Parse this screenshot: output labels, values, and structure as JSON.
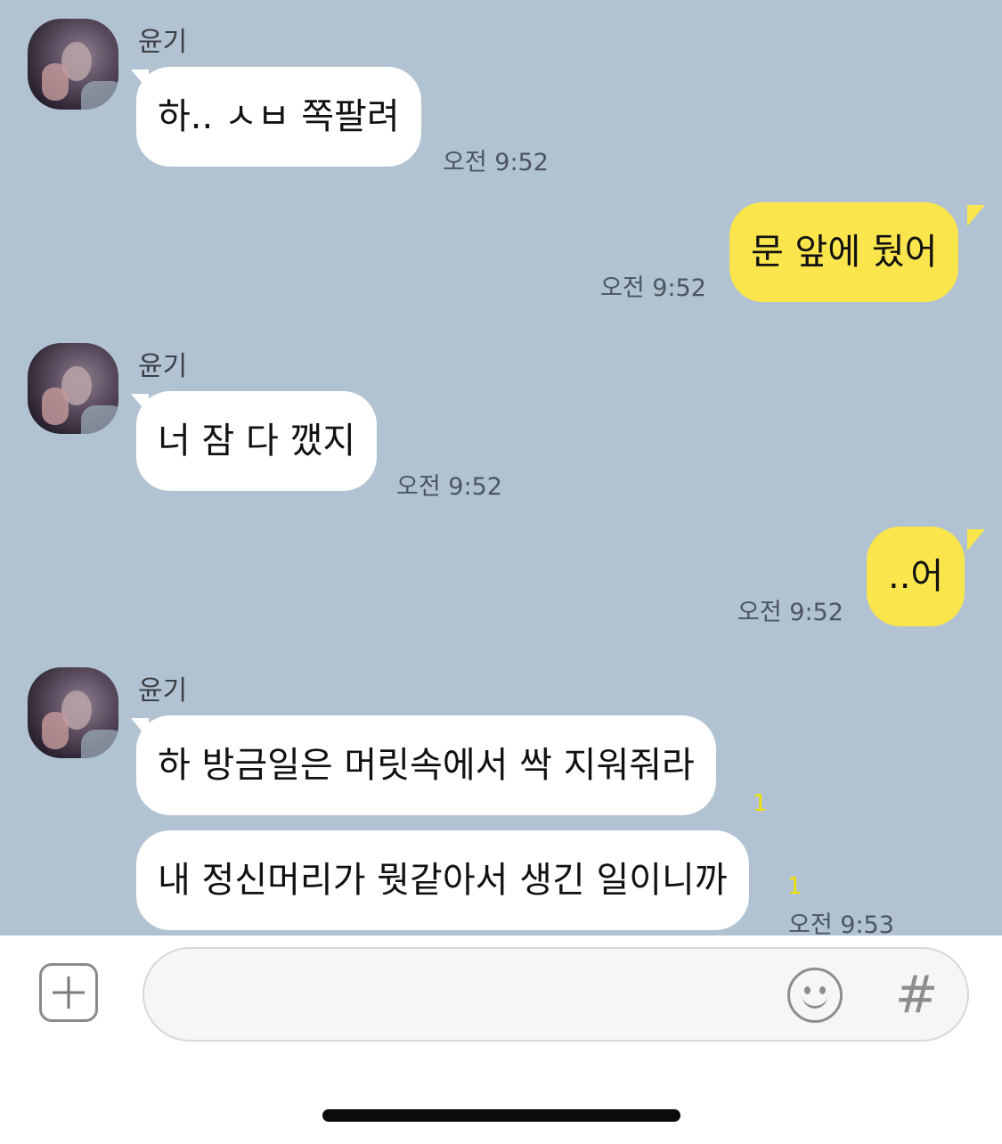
{
  "messages": [
    {
      "sender": "윤기",
      "direction": "incoming",
      "text": "하.. ㅅㅂ 쪽팔려",
      "time": "오전 9:52"
    },
    {
      "direction": "outgoing",
      "text": "문 앞에 뒀어",
      "time": "오전 9:52"
    },
    {
      "sender": "윤기",
      "direction": "incoming",
      "text": "너 잠 다 깼지",
      "time": "오전 9:52"
    },
    {
      "direction": "outgoing",
      "text": "..어",
      "time": "오전 9:52"
    },
    {
      "sender": "윤기",
      "direction": "incoming",
      "text": "하 방금일은 머릿속에서 싹 지워줘라",
      "unread": "1"
    },
    {
      "direction": "incoming",
      "text": "내 정신머리가 뭣같아서 생긴 일이니까",
      "unread": "1",
      "time": "오전 9:53"
    }
  ],
  "input_bar": {
    "plus_icon": "plus-square-icon",
    "placeholder": "",
    "emoji_icon": "smiley-icon",
    "hash_label": "#"
  },
  "colors": {
    "chat_background": "#b1c2d2",
    "incoming_bubble": "#ffffff",
    "outgoing_bubble": "#fae64c",
    "unread_count": "#f2e100"
  }
}
